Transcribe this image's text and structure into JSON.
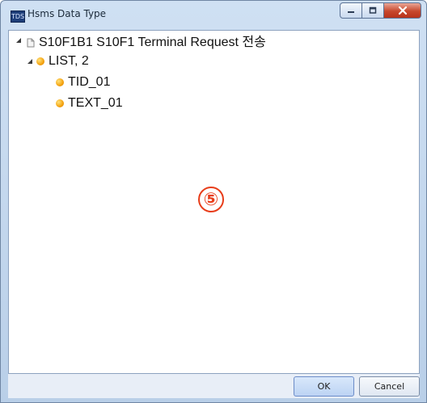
{
  "window": {
    "title": "Hsms Data Type",
    "app_icon_text": "TDS"
  },
  "tree": [
    {
      "label": "S10F1B1 S10F1 Terminal Request 전송",
      "level": 0,
      "expanded": true,
      "icon": "document-icon"
    },
    {
      "label": "LIST, 2",
      "level": 1,
      "expanded": true,
      "icon": "orange-dot-icon"
    },
    {
      "label": "TID_01",
      "level": 2,
      "expanded": false,
      "icon": "orange-dot-icon"
    },
    {
      "label": "TEXT_01",
      "level": 2,
      "expanded": false,
      "icon": "orange-dot-icon"
    }
  ],
  "annotation": {
    "marker": "⑤"
  },
  "buttons": {
    "ok": "OK",
    "cancel": "Cancel"
  },
  "colors": {
    "title_gradient_top": "#cfe0f3",
    "title_gradient_bottom": "#b9cfe8",
    "close_red": "#c7472c",
    "dot_orange": "#f4a20f",
    "marker_red": "#e83d1a"
  }
}
